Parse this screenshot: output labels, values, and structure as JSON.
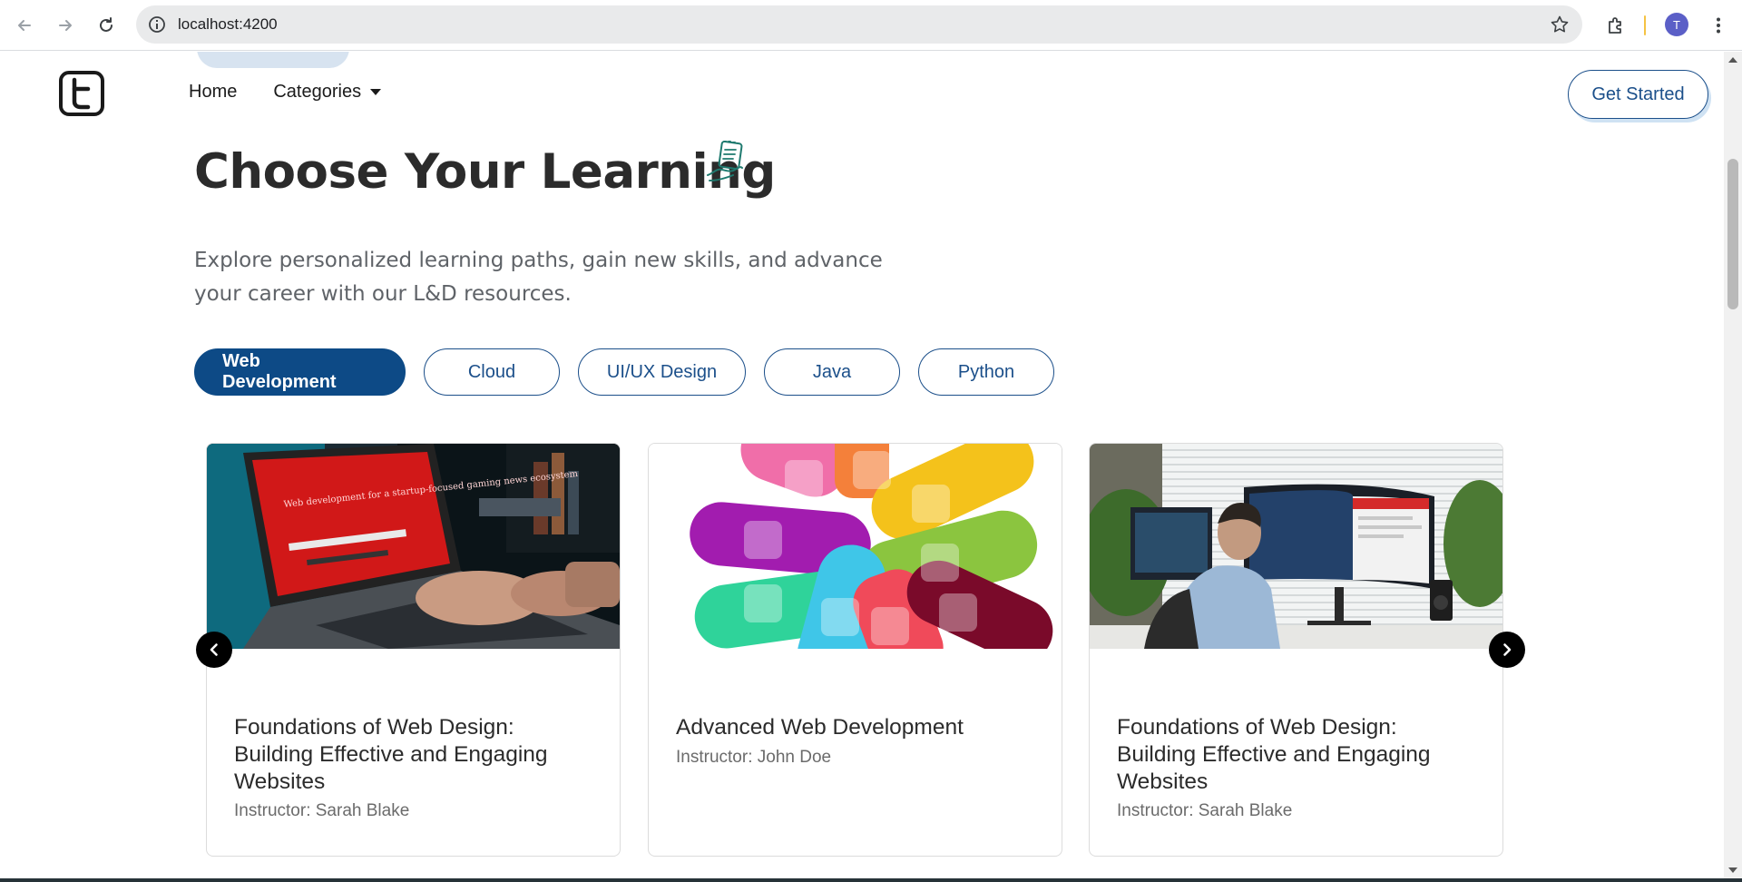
{
  "browser": {
    "url": "localhost:4200",
    "profile_initial": "T"
  },
  "site": {
    "nav": {
      "home": "Home",
      "categories": "Categories"
    },
    "get_started": "Get Started"
  },
  "hero": {
    "title": "Choose Your Learning",
    "subtitle": "Explore personalized learning paths, gain new skills, and advance your career with our L&D resources."
  },
  "categories": [
    {
      "label": "Web Development",
      "active": true
    },
    {
      "label": "Cloud",
      "active": false
    },
    {
      "label": "UI/UX Design",
      "active": false
    },
    {
      "label": "Java",
      "active": false
    },
    {
      "label": "Python",
      "active": false
    }
  ],
  "courses": [
    {
      "title": "Foundations of Web Design: Building Effective and Engaging Websites",
      "instructor": "Instructor: Sarah Blake"
    },
    {
      "title": "Advanced Web Development",
      "instructor": "Instructor: John Doe"
    },
    {
      "title": "Foundations of Web Design: Building Effective and Engaging Websites",
      "instructor": "Instructor: Sarah Blake"
    }
  ],
  "laptop_screen_text": "Web development for a startup-focused gaming news ecosystem",
  "colors": {
    "primary": "#0d4a86",
    "outline": "#1b4f8a",
    "text_dark": "#2b2b2b",
    "text_muted": "#5f6368"
  }
}
